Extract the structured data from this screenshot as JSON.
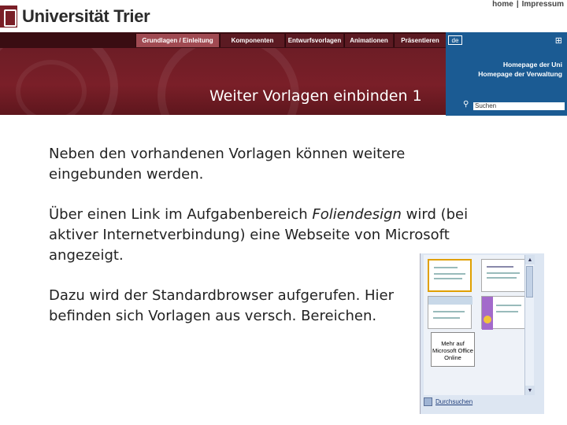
{
  "header": {
    "logo_text": "Universität Trier",
    "links": [
      "home",
      "Impressum"
    ],
    "link_separator": "|"
  },
  "nav": {
    "tabs": [
      {
        "label": "Grundlagen / Einleitung",
        "active": true
      },
      {
        "label": "Komponenten",
        "active": false
      },
      {
        "label": "Entwurfsvorlagen",
        "active": false
      },
      {
        "label": "Animationen",
        "active": false
      },
      {
        "label": "Präsentieren",
        "active": false
      }
    ]
  },
  "banner": {
    "title": "Weiter Vorlagen einbinden 1"
  },
  "sidepanel": {
    "lang": "de",
    "links": [
      "Homepage der Uni",
      "Homepage der Verwaltung"
    ],
    "search_placeholder": "Suchen"
  },
  "content": {
    "p1": "Neben den vorhandenen Vorlagen können weitere eingebunden werden.",
    "p2_before": "Über einen Link im Aufgabenbereich ",
    "p2_em": "Foliendesign",
    "p2_after": " wird (bei aktiver Internetverbindung) eine Webseite von Microsoft angezeigt.",
    "p3": "Dazu wird der Standardbrowser aufgerufen. Hier befinden sich Vorlagen aus versch. Bereichen."
  },
  "gallery": {
    "more_templates": "Mehr auf Microsoft Office Online",
    "browse_label": "Durchsuchen"
  },
  "colors": {
    "brand_red": "#7a1f28",
    "nav_dark": "#3a0d12",
    "panel_blue": "#1b5b93"
  }
}
